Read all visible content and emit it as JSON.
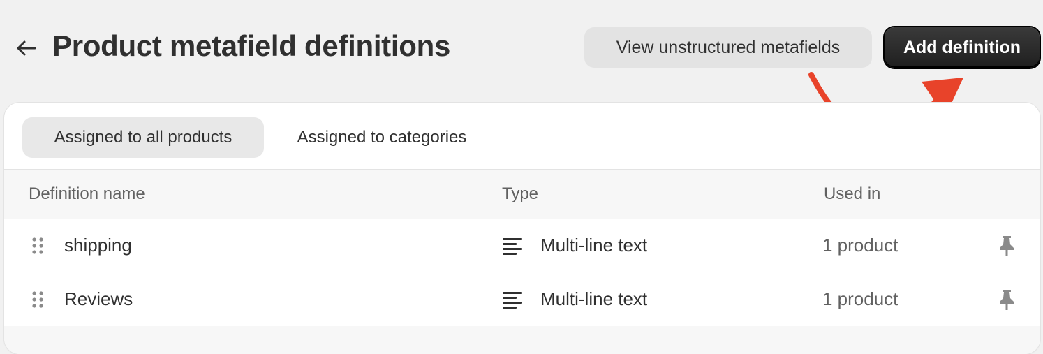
{
  "header": {
    "title": "Product metafield definitions",
    "back_icon": "arrow-left-icon",
    "secondary_button_label": "View unstructured metafields",
    "primary_button_label": "Add definition"
  },
  "annotation": {
    "arrow_color": "#e8432a",
    "arrow_icon": "curved-arrow-icon"
  },
  "tabs": [
    {
      "label": "Assigned to all products",
      "selected": true
    },
    {
      "label": "Assigned to categories",
      "selected": false
    }
  ],
  "table": {
    "columns": [
      "Definition name",
      "Type",
      "Used in"
    ],
    "rows": [
      {
        "name": "shipping",
        "type": "Multi-line text",
        "used_in": "1 product"
      },
      {
        "name": "Reviews",
        "type": "Multi-line text",
        "used_in": "1 product"
      }
    ]
  },
  "colors": {
    "primary_button_bg": "#303030",
    "secondary_button_bg": "#e3e3e3",
    "page_bg": "#f1f1f1"
  }
}
